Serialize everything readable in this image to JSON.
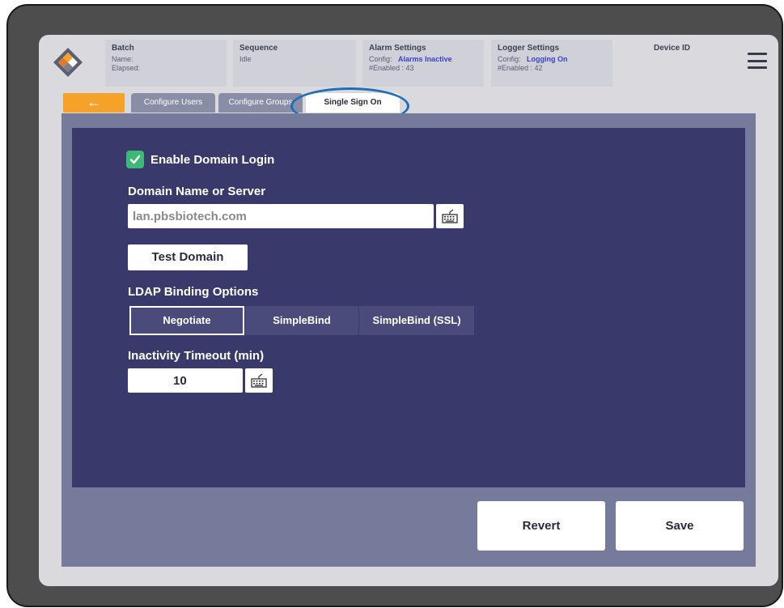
{
  "header": {
    "batch": {
      "title": "Batch",
      "name_label": "Name:",
      "elapsed_label": "Elapsed:"
    },
    "sequence": {
      "title": "Sequence",
      "value": "Idle"
    },
    "alarm": {
      "title": "Alarm Settings",
      "config_label": "Config:",
      "config_value": "Alarms Inactive",
      "enabled_text": "#Enabled : 43"
    },
    "logger": {
      "title": "Logger Settings",
      "config_label": "Config:",
      "config_value": "Logging On",
      "enabled_text": "#Enabled : 42"
    },
    "device_id_label": "Device ID",
    "menu_icon": "hamburger-menu-icon"
  },
  "tabs": {
    "back_symbol": "←",
    "items": [
      {
        "label": "Configure Users",
        "active": false
      },
      {
        "label": "Configure Groups",
        "active": false
      },
      {
        "label": "Single Sign On",
        "active": true
      }
    ]
  },
  "form": {
    "enable_domain_login": {
      "label": "Enable Domain Login",
      "checked": true
    },
    "domain": {
      "label": "Domain Name or Server",
      "value": "lan.pbsbiotech.com"
    },
    "test_button": "Test Domain",
    "ldap": {
      "label": "LDAP Binding Options",
      "options": [
        "Negotiate",
        "SimpleBind",
        "SimpleBind (SSL)"
      ],
      "selected": "Negotiate"
    },
    "timeout": {
      "label": "Inactivity Timeout (min)",
      "value": "10"
    }
  },
  "actions": {
    "revert": "Revert",
    "save": "Save"
  },
  "colors": {
    "accent_orange": "#f5a12a",
    "panel_dark": "#393a6b",
    "check_green": "#3cb878",
    "highlight_blue": "#1f6fb8"
  }
}
